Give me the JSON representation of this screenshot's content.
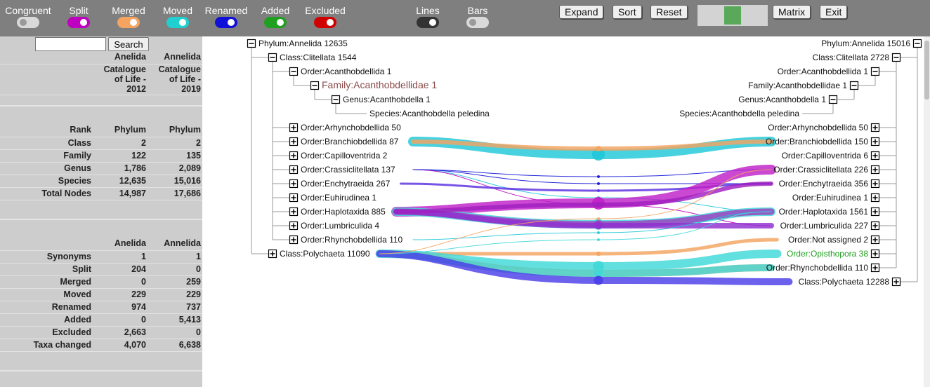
{
  "toolbar": {
    "toggles": [
      {
        "label": "Congruent",
        "color": "#7f7f7f",
        "on": false
      },
      {
        "label": "Split",
        "color": "#c000c0",
        "on": true
      },
      {
        "label": "Merged",
        "color": "#f4a460",
        "on": true
      },
      {
        "label": "Moved",
        "color": "#20d0d0",
        "on": true
      },
      {
        "label": "Renamed",
        "color": "#1010d8",
        "on": true
      },
      {
        "label": "Added",
        "color": "#20a020",
        "on": true
      },
      {
        "label": "Excluded",
        "color": "#d00000",
        "on": true
      },
      {
        "label": "Lines",
        "color": "#333333",
        "on": true
      },
      {
        "label": "Bars",
        "color": "#bdbdbd",
        "on": false
      }
    ],
    "buttons": {
      "expand": "Expand",
      "sort": "Sort",
      "reset": "Reset",
      "matrix": "Matrix",
      "exit": "Exit"
    }
  },
  "search": {
    "placeholder": "",
    "button": "Search"
  },
  "header": {
    "left_name": "Anelida",
    "right_name": "Annelida",
    "left_source": "Catalogue of Life - 2012",
    "right_source": "Catalogue of Life - 2019"
  },
  "rank_table": {
    "headers": [
      "Rank",
      "Phylum",
      "Phylum"
    ],
    "rows": [
      [
        "Class",
        "2",
        "2"
      ],
      [
        "Family",
        "122",
        "135"
      ],
      [
        "Genus",
        "1,786",
        "2,089"
      ],
      [
        "Species",
        "12,635",
        "15,016"
      ],
      [
        "Total Nodes",
        "14,987",
        "17,686"
      ]
    ]
  },
  "change_table": {
    "headers": [
      "",
      "Anelida",
      "Annelida"
    ],
    "rows": [
      [
        "Synonyms",
        "1",
        "1"
      ],
      [
        "Split",
        "204",
        "0"
      ],
      [
        "Merged",
        "0",
        "259"
      ],
      [
        "Moved",
        "229",
        "229"
      ],
      [
        "Renamed",
        "974",
        "737"
      ],
      [
        "Added",
        "0",
        "5,413"
      ],
      [
        "Excluded",
        "2,663",
        "0"
      ],
      [
        "Taxa changed",
        "4,070",
        "6,638"
      ]
    ]
  },
  "left_tree": [
    {
      "label": "Phylum:Annelida 12635",
      "depth": 0,
      "toggle": "minus"
    },
    {
      "label": "Class:Clitellata 1544",
      "depth": 1,
      "toggle": "minus"
    },
    {
      "label": "Order:Acanthobdellida 1",
      "depth": 2,
      "toggle": "minus"
    },
    {
      "label": "Family:Acanthobdellidae 1",
      "depth": 3,
      "toggle": "minus",
      "color": "#8a4a4a",
      "size": 14
    },
    {
      "label": "Genus:Acanthobdella 1",
      "depth": 4,
      "toggle": "minus"
    },
    {
      "label": "Species:Acanthobdella peledina",
      "depth": 5,
      "toggle": "none"
    },
    {
      "label": "Order:Arhynchobdellida 50",
      "depth": 2,
      "toggle": "plus"
    },
    {
      "label": "Order:Branchiobdellida 87",
      "depth": 2,
      "toggle": "plus"
    },
    {
      "label": "Order:Capilloventrida 2",
      "depth": 2,
      "toggle": "plus"
    },
    {
      "label": "Order:Crassiclitellata 137",
      "depth": 2,
      "toggle": "plus"
    },
    {
      "label": "Order:Enchytraeida 267",
      "depth": 2,
      "toggle": "plus"
    },
    {
      "label": "Order:Euhirudinea 1",
      "depth": 2,
      "toggle": "plus"
    },
    {
      "label": "Order:Haplotaxida 885",
      "depth": 2,
      "toggle": "plus"
    },
    {
      "label": "Order:Lumbriculida 4",
      "depth": 2,
      "toggle": "plus"
    },
    {
      "label": "Order:Rhynchobdellida 110",
      "depth": 2,
      "toggle": "plus"
    },
    {
      "label": "Class:Polychaeta 11090",
      "depth": 1,
      "toggle": "plus"
    }
  ],
  "right_tree": [
    {
      "label": "Phylum:Annelida 15016",
      "depth": 0,
      "toggle": "minus"
    },
    {
      "label": "Class:Clitellata 2728",
      "depth": 1,
      "toggle": "minus"
    },
    {
      "label": "Order:Acanthobdellida 1",
      "depth": 2,
      "toggle": "minus"
    },
    {
      "label": "Family:Acanthobdellidae 1",
      "depth": 3,
      "toggle": "minus"
    },
    {
      "label": "Genus:Acanthobdella 1",
      "depth": 4,
      "toggle": "minus"
    },
    {
      "label": "Species:Acanthobdella peledina",
      "depth": 5,
      "toggle": "none"
    },
    {
      "label": "Order:Arhynchobdellida 50",
      "depth": 2,
      "toggle": "plus"
    },
    {
      "label": "Order:Branchiobdellida 150",
      "depth": 2,
      "toggle": "plus"
    },
    {
      "label": "Order:Capilloventrida 6",
      "depth": 2,
      "toggle": "plus"
    },
    {
      "label": "Order:Crassiclitellata 226",
      "depth": 2,
      "toggle": "plus"
    },
    {
      "label": "Order:Enchytraeida 356",
      "depth": 2,
      "toggle": "plus"
    },
    {
      "label": "Order:Euhirudinea 1",
      "depth": 2,
      "toggle": "plus"
    },
    {
      "label": "Order:Haplotaxida 1561",
      "depth": 2,
      "toggle": "plus"
    },
    {
      "label": "Order:Lumbriculida 227",
      "depth": 2,
      "toggle": "plus"
    },
    {
      "label": "Order:Not assigned 2",
      "depth": 2,
      "toggle": "plus"
    },
    {
      "label": "Order:Opisthopora 38",
      "depth": 2,
      "toggle": "plus",
      "color": "#20a020"
    },
    {
      "label": "Order:Rhynchobdellida 110",
      "depth": 2,
      "toggle": "plus"
    },
    {
      "label": "Class:Polychaeta 12288",
      "depth": 1,
      "toggle": "plus"
    }
  ],
  "flows": [
    {
      "from": 7,
      "to": 7,
      "color": "#20c8d8",
      "width": 14
    },
    {
      "from": 7,
      "to": 7,
      "color": "#f4a460",
      "width": 6
    },
    {
      "from": 9,
      "to": 9,
      "color": "#1010d8",
      "width": 1
    },
    {
      "from": 9,
      "to": 12,
      "color": "#20c8d8",
      "width": 1
    },
    {
      "from": 9,
      "to": 13,
      "color": "#c000c0",
      "width": 1
    },
    {
      "from": 9,
      "to": 10,
      "color": "#1010d8",
      "width": 1
    },
    {
      "from": 10,
      "to": 10,
      "color": "#5a2ee0",
      "width": 3
    },
    {
      "from": 12,
      "to": 9,
      "color": "#c020c8",
      "width": 14
    },
    {
      "from": 12,
      "to": 12,
      "color": "#40d8d8",
      "width": 12
    },
    {
      "from": 12,
      "to": 12,
      "color": "#a040c0",
      "width": 9
    },
    {
      "from": 12,
      "to": 13,
      "color": "#9030d0",
      "width": 8
    },
    {
      "from": 12,
      "to": 10,
      "color": "#a020c0",
      "width": 6
    },
    {
      "from": 14,
      "to": 12,
      "color": "#20c8d8",
      "width": 1
    },
    {
      "from": 15,
      "to": 14,
      "color": "#f4a460",
      "width": 5
    },
    {
      "from": 15,
      "to": 15,
      "color": "#40d8d8",
      "width": 12
    },
    {
      "from": 15,
      "to": 16,
      "color": "#f4a460",
      "width": 10
    },
    {
      "from": 15,
      "to": 16,
      "color": "#40d8d8",
      "width": 10
    },
    {
      "from": 15,
      "to": 17,
      "color": "#4a3ee8",
      "width": 10
    },
    {
      "from": 15,
      "to": 12,
      "color": "#40d8d8",
      "width": 1
    },
    {
      "from": 15,
      "to": 9,
      "color": "#f4a460",
      "width": 1
    }
  ]
}
